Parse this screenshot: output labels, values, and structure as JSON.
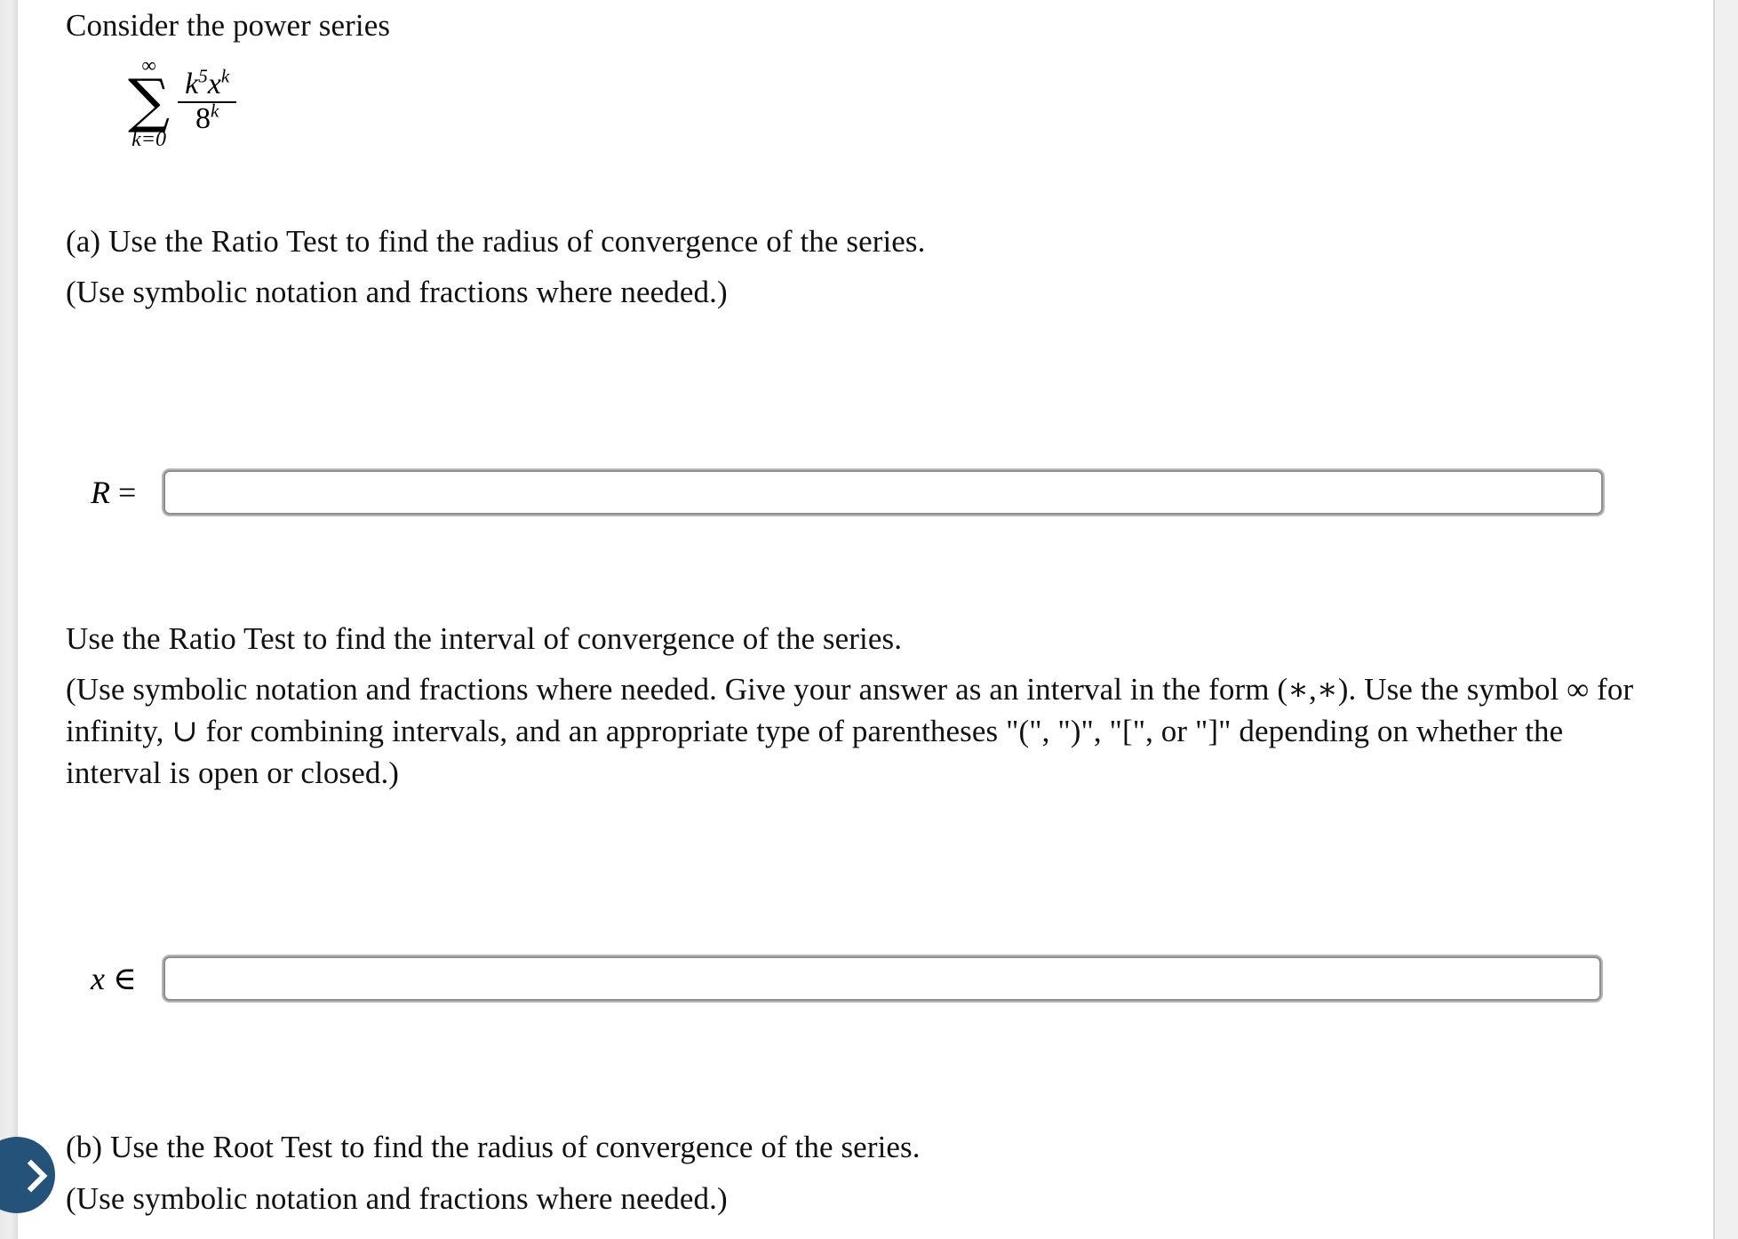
{
  "document": {
    "intro_text": "Consider the power series",
    "formula": {
      "upper_limit": "∞",
      "lower_limit": "k=0",
      "sigma": "∑",
      "numerator_base_1": "k",
      "numerator_exp_1": "5",
      "numerator_base_2": "x",
      "numerator_exp_2": "k",
      "denominator_base": "8",
      "denominator_exp": "k",
      "plain": "sum from k=0 to infinity of (k^5 x^k) / 8^k"
    },
    "part_a": {
      "prompt": "(a) Use the Ratio Test to find the radius of convergence of the series.",
      "note": "(Use symbolic notation and fractions where needed.)",
      "answer_label_var": "R",
      "answer_label_op": " =",
      "answer_value": "",
      "answer_placeholder": ""
    },
    "interval_section": {
      "prompt": "Use the Ratio Test to find the interval of convergence of the series.",
      "note": "(Use symbolic notation and fractions where needed. Give your answer as an interval in the form (∗,∗). Use the symbol ∞ for infinity, ∪ for combining intervals, and an appropriate type of parentheses \"(\", \")\", \"[\", or \"]\" depending on whether the interval is open or closed.)",
      "answer_label_var": "x",
      "answer_label_op": " ∈",
      "answer_value": "",
      "answer_placeholder": ""
    },
    "part_b": {
      "prompt": "(b) Use the Root Test to find the radius of convergence of the series.",
      "note": "(Use symbolic notation and fractions where needed.)"
    },
    "nav": {
      "next_icon": "chevron-right-icon",
      "bubble_color": "#255278"
    },
    "colors": {
      "page_background": "#ffffff",
      "outer_background": "#f0f0f0",
      "input_border": "#8e8e8e",
      "input_outer_border": "#b6b6b6",
      "text": "#111111"
    }
  }
}
